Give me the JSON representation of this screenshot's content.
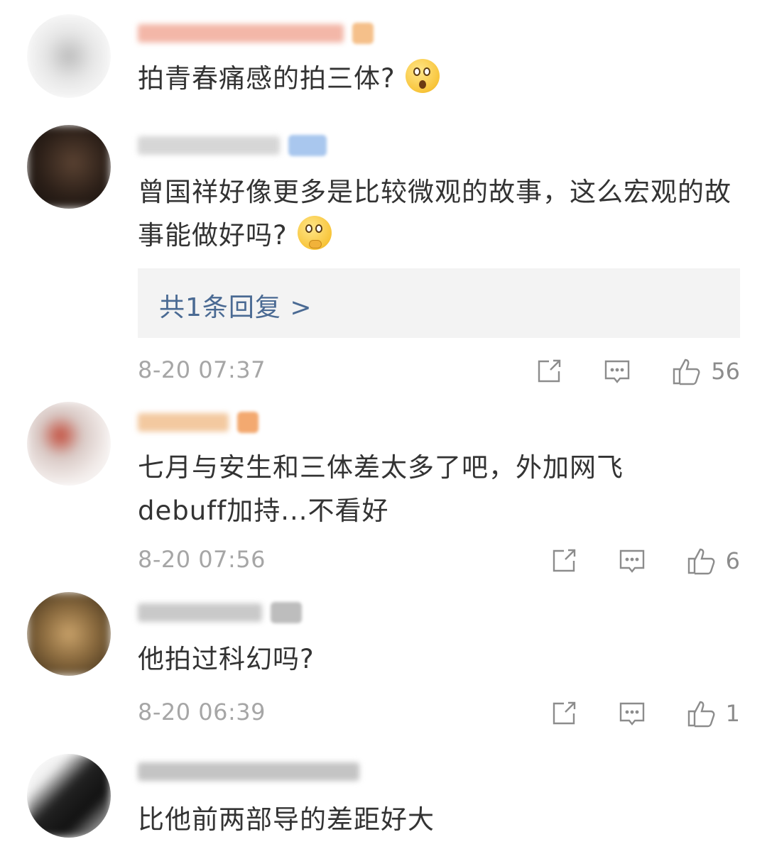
{
  "comments": [
    {
      "text": "拍青春痛感的拍三体?",
      "emoji": "astonished-face",
      "colors": {
        "avatar": [
          "#e9e9e9",
          "#bdbdbd"
        ],
        "name": "#f3b7a8",
        "badge": "#f5c08a"
      }
    },
    {
      "text": "曾国祥好像更多是比较微观的故事，这么宏观的故事能做好吗?",
      "emoji": "thinking-face",
      "reply_link": "共1条回复 >",
      "timestamp": "8-20 07:37",
      "likes": "56",
      "colors": {
        "avatar": [
          "#3a2a22",
          "#1b1612"
        ],
        "name": "#d2d2d2",
        "badge": "#a9c7ee"
      }
    },
    {
      "text": "七月与安生和三体差太多了吧，外加网飞debuff加持...不看好",
      "timestamp": "8-20 07:56",
      "likes": "6",
      "colors": {
        "avatar": [
          "#e3d8d4",
          "#b24a3a"
        ],
        "name": "#f3c9a0",
        "badge": "#f3a970"
      }
    },
    {
      "text": "他拍过科幻吗?",
      "timestamp": "8-20 06:39",
      "likes": "1",
      "colors": {
        "avatar": [
          "#9a7a4a",
          "#3b2c18"
        ],
        "name": "#c9c9c9",
        "badge": "#bdbdbd"
      }
    },
    {
      "text": "比他前两部导的差距好大",
      "colors": {
        "avatar": [
          "#222222",
          "#f0f0f0"
        ],
        "name": "#bdbdbd",
        "badge": "#bdbdbd"
      }
    }
  ],
  "icons": {
    "share": "share-icon",
    "comment": "comment-icon",
    "like": "thumbs-up-icon"
  },
  "accent": "#4a6a93"
}
